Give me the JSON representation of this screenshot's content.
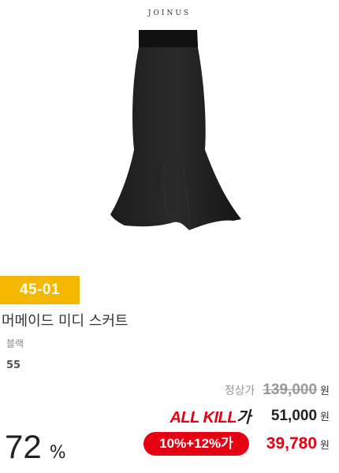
{
  "brand": "JOINUS",
  "product": {
    "code": "45-01",
    "name": "머메이드 미디 스커트",
    "color": "블랙",
    "size": "55",
    "image_alt_icon": "skirt-product-image"
  },
  "pricing": {
    "regular_label": "정상가",
    "regular_price": "139,000",
    "allkill_logo_red": "ALL KILL",
    "allkill_logo_dark": "가",
    "allkill_price": "51,000",
    "coupon": "10%+12%가",
    "final_price": "39,780",
    "currency": "원",
    "discount_value": "72",
    "discount_unit": "%"
  },
  "colors": {
    "badge": "#f5b800",
    "accent_red": "#e60012"
  }
}
